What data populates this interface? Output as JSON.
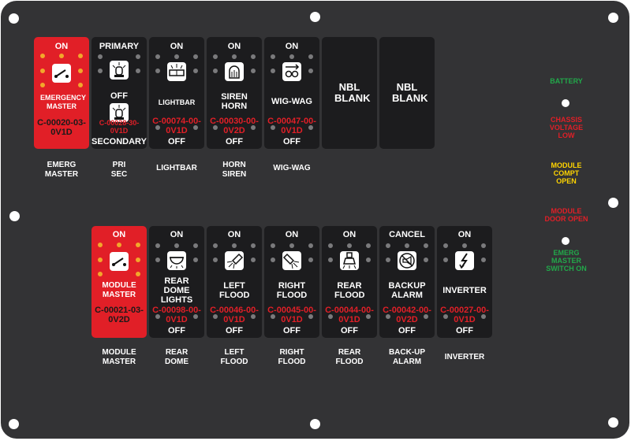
{
  "colors": {
    "plate": "#333335",
    "switch": "#1c1c1e",
    "red_switch": "#e11f27",
    "led_off": "#7a7a7c",
    "led_on": "#f2a72b",
    "part_text": "#e11f27",
    "green": "#22a84a",
    "red": "#e11f27",
    "yellow": "#ffd400"
  },
  "row1": [
    {
      "top": "ON",
      "mid": "EMERGENCY MASTER",
      "part": "C-00020-03-0V1D",
      "icon": "toggle-switch-icon",
      "caption": "EMERG MASTER"
    },
    {
      "top": "PRIMARY",
      "mid": "OFF",
      "part": "C-00028-30-0V1D",
      "bottom": "SECONDARY",
      "icon": "primary-beacon-icon",
      "icon2": "secondary-beacon-icon",
      "caption": "PRI SEC"
    },
    {
      "top": "ON",
      "mid": "LIGHTBAR",
      "part": "C-00074-00-0V1D",
      "bottom": "OFF",
      "icon": "lightbar-icon",
      "caption": "LIGHTBAR"
    },
    {
      "top": "ON",
      "mid": "SIREN HORN",
      "part": "C-00030-00-0V2D",
      "bottom": "OFF",
      "icon": "siren-horn-icon",
      "caption": "HORN SIREN"
    },
    {
      "top": "ON",
      "mid": "WIG-WAG",
      "part": "C-00047-00-0V1D",
      "bottom": "OFF",
      "icon": "wig-wag-icon",
      "caption": "WIG-WAG"
    },
    {
      "label": "NBL BLANK"
    },
    {
      "label": "NBL BLANK"
    }
  ],
  "row2": [
    {
      "top": "ON",
      "mid": "MODULE MASTER",
      "part": "C-00021-03-0V2D",
      "icon": "toggle-switch-icon",
      "caption": "MODULE MASTER"
    },
    {
      "top": "ON",
      "mid": "REAR DOME LIGHTS",
      "part": "C-00098-00-0V1D",
      "bottom": "OFF",
      "icon": "dome-light-icon",
      "caption": "REAR DOME"
    },
    {
      "top": "ON",
      "mid": "LEFT FLOOD",
      "part": "C-00046-00-0V1D",
      "bottom": "OFF",
      "icon": "left-flood-icon",
      "caption": "LEFT FLOOD"
    },
    {
      "top": "ON",
      "mid": "RIGHT FLOOD",
      "part": "C-00045-00-0V1D",
      "bottom": "OFF",
      "icon": "right-flood-icon",
      "caption": "RIGHT FLOOD"
    },
    {
      "top": "ON",
      "mid": "REAR FLOOD",
      "part": "C-00044-00-0V1D",
      "bottom": "OFF",
      "icon": "rear-flood-icon",
      "caption": "REAR FLOOD"
    },
    {
      "top": "CANCEL",
      "mid": "BACKUP ALARM",
      "part": "C-00042-00-0V2D",
      "bottom": "OFF",
      "icon": "backup-alarm-icon",
      "caption": "BACK-UP ALARM"
    },
    {
      "top": "ON",
      "mid": "INVERTER",
      "part": "C-00027-00-0V1D",
      "bottom": "OFF",
      "icon": "inverter-icon",
      "caption": "INVERTER"
    }
  ],
  "indicators": [
    {
      "label": "BATTERY",
      "color": "green"
    },
    {
      "label": "CHASSIS VOLTAGE LOW",
      "color": "red"
    },
    {
      "label": "MODULE COMPT OPEN",
      "color": "yellow"
    },
    {
      "label": "MODULE DOOR OPEN",
      "color": "red"
    },
    {
      "label": "EMERG MASTER SWITCH ON",
      "color": "green"
    }
  ]
}
